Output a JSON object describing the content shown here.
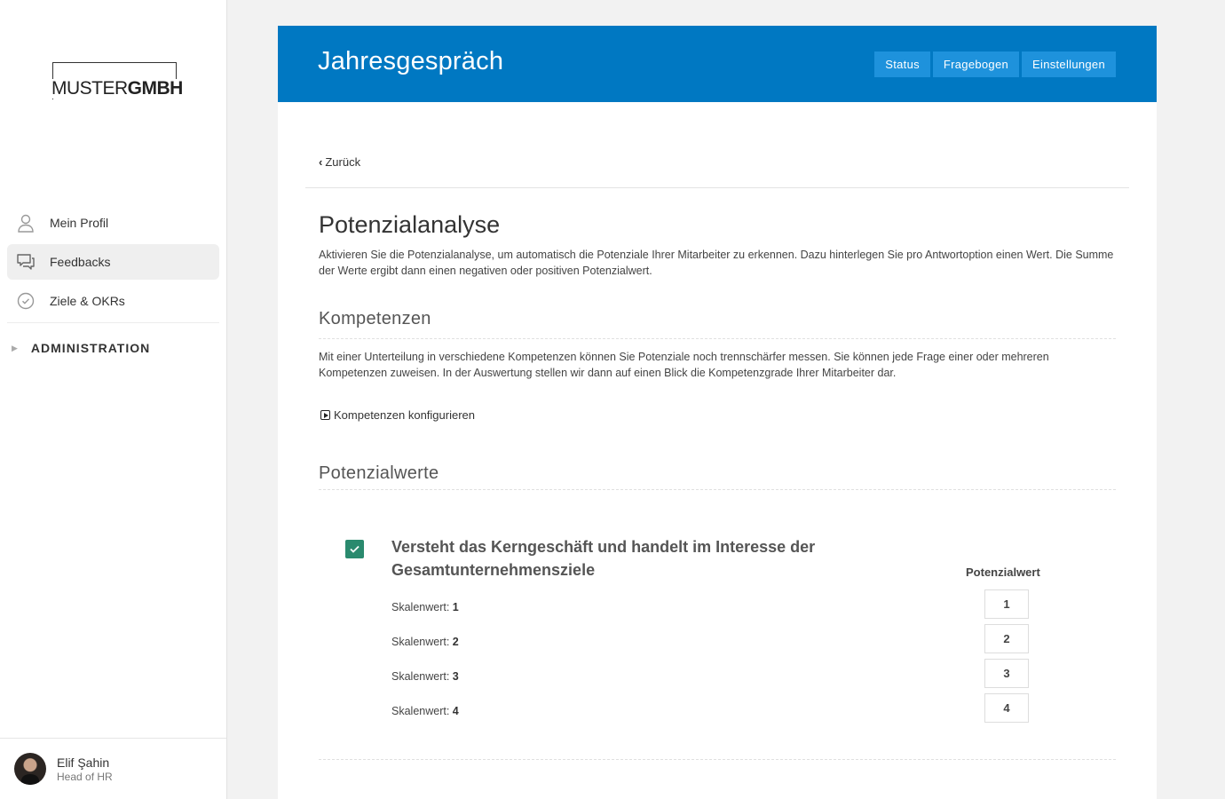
{
  "brand": {
    "logo_light": "MUSTER",
    "logo_bold": "GMBH"
  },
  "sidebar": {
    "items": [
      {
        "label": "Mein Profil",
        "icon": "user-icon",
        "active": false
      },
      {
        "label": "Feedbacks",
        "icon": "chat-icon",
        "active": true
      },
      {
        "label": "Ziele & OKRs",
        "icon": "check-circle-icon",
        "active": false
      }
    ],
    "admin_label": "ADMINISTRATION",
    "user": {
      "name": "Elif Şahin",
      "role": "Head of HR"
    }
  },
  "header": {
    "title": "Jahresgespräch",
    "buttons": [
      "Status",
      "Fragebogen",
      "Einstellungen"
    ],
    "color": "#0078c2"
  },
  "main": {
    "back_label": "Zurück",
    "title": "Potenzialanalyse",
    "intro": "Aktivieren Sie die Potenzialanalyse, um automatisch die Potenziale Ihrer Mitarbeiter zu erkennen. Dazu hinterlegen Sie pro Antwortoption einen Wert. Die Summe der Werte ergibt dann einen negativen oder positiven Potenzialwert.",
    "kompetenzen": {
      "heading": "Kompetenzen",
      "text": "Mit einer Unterteilung in verschiedene Kompetenzen können Sie Potenziale noch trennschärfer messen. Sie können jede Frage einer oder mehreren Kompetenzen zuweisen. In der Auswertung stellen wir dann auf einen Blick die Kompetenzgrade Ihrer Mitarbeiter dar.",
      "config_label": "Kompetenzen konfigurieren"
    },
    "potenzialwerte": {
      "heading": "Potenzialwerte",
      "question": "Versteht das Kerngeschäft und handelt im Interesse der Gesamtunternehmensziele",
      "checked": true,
      "value_header": "Potenzialwert",
      "scale_prefix": "Skalenwert:",
      "rows": [
        {
          "scale": "1",
          "value": "1"
        },
        {
          "scale": "2",
          "value": "2"
        },
        {
          "scale": "3",
          "value": "3"
        },
        {
          "scale": "4",
          "value": "4"
        }
      ]
    }
  }
}
